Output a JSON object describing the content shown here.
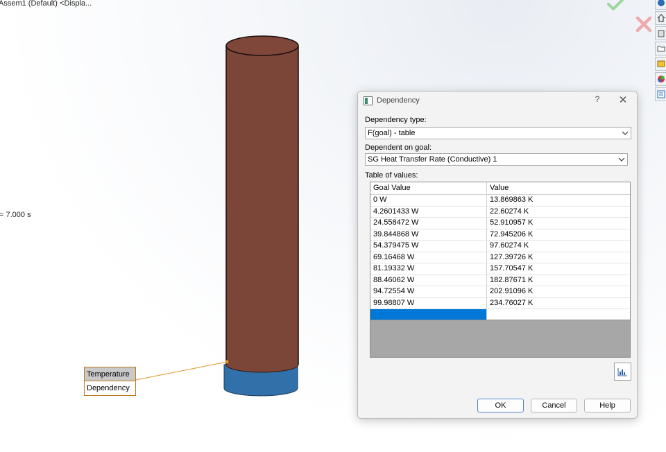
{
  "viewport": {
    "doc_title": "Assem1 (Default) <Displa...",
    "time_label": "= 7.000 s"
  },
  "callout": {
    "title": "Temperature",
    "body": "Dependency"
  },
  "toolbar": {
    "icons": [
      "view-orientation-icon",
      "home-icon",
      "parts-icon",
      "folder-icon",
      "design-library-icon",
      "appearances-icon",
      "properties-icon"
    ]
  },
  "dialog": {
    "title": "Dependency",
    "help_glyph": "?",
    "close_glyph": "✕",
    "dependency_type_label": "Dependency type:",
    "dependency_type_value": "F(goal) - table",
    "dependent_goal_label": "Dependent on goal:",
    "dependent_goal_value": "SG Heat Transfer Rate (Conductive) 1",
    "table_label": "Table of values:",
    "table": {
      "headers": [
        "Goal Value",
        "Value"
      ],
      "rows": [
        [
          "0 W",
          "13.869863 K"
        ],
        [
          "4.2601433 W",
          "22.60274 K"
        ],
        [
          "24.558472 W",
          "52.910957 K"
        ],
        [
          "39.844868 W",
          "72.945206 K"
        ],
        [
          "54.379475 W",
          "97.60274 K"
        ],
        [
          "69.16468 W",
          "127.39726 K"
        ],
        [
          "81.19332 W",
          "157.70547 K"
        ],
        [
          "88.46062 W",
          "182.87671 K"
        ],
        [
          "94.72554 W",
          "202.91096 K"
        ],
        [
          "99.98807 W",
          "234.76027 K"
        ]
      ]
    },
    "buttons": {
      "ok": "OK",
      "cancel": "Cancel",
      "help": "Help"
    }
  },
  "colors": {
    "cylinder_body": "#7b4537",
    "cylinder_top": "#7f4739",
    "cylinder_base": "#3170a8",
    "callout_border": "#c07a1d",
    "selection": "#0078d7"
  }
}
